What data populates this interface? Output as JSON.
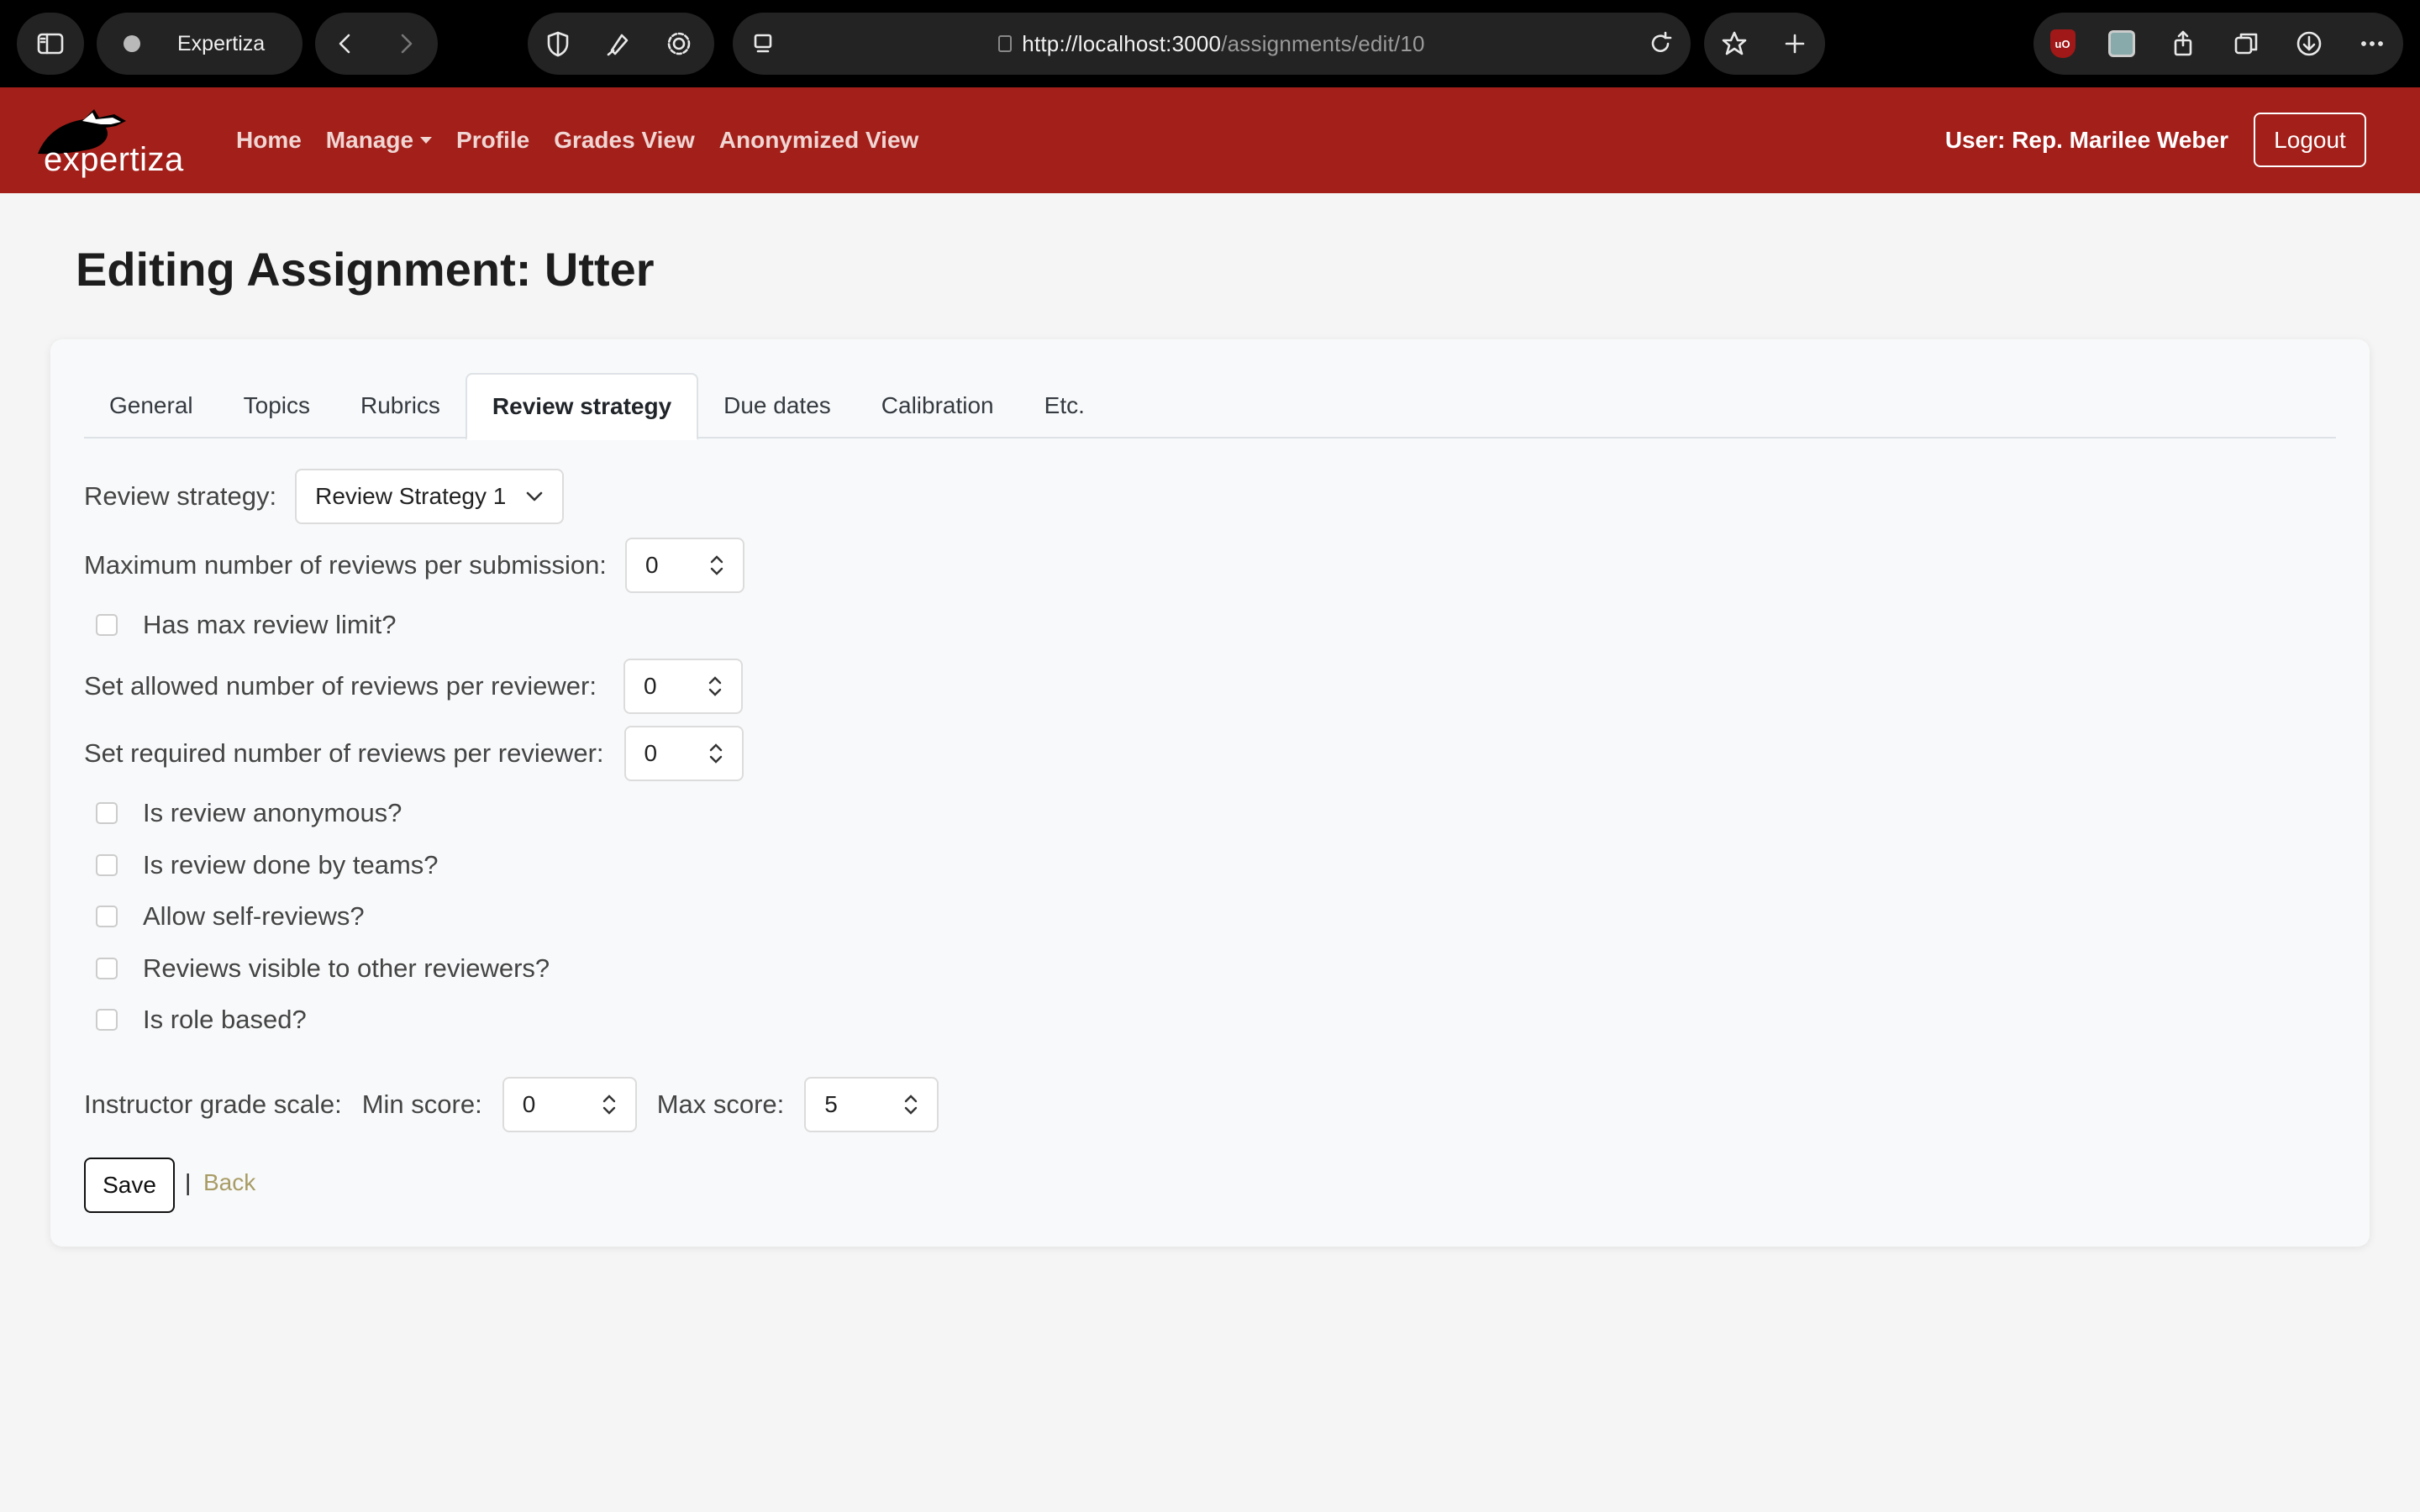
{
  "browser": {
    "tab_title": "Expertiza",
    "url_host": "http://localhost:3000",
    "url_path": "/assignments/edit/10"
  },
  "navbar": {
    "logo_text": "expertiza",
    "links": [
      "Home",
      "Manage",
      "Profile",
      "Grades View",
      "Anonymized View"
    ],
    "user_label": "User: Rep. Marilee Weber",
    "logout_label": "Logout"
  },
  "page": {
    "title": "Editing Assignment: Utter"
  },
  "tabs": [
    "General",
    "Topics",
    "Rubrics",
    "Review strategy",
    "Due dates",
    "Calibration",
    "Etc."
  ],
  "active_tab": "Review strategy",
  "form": {
    "review_strategy_label": "Review strategy:",
    "review_strategy_value": "Review Strategy 1",
    "max_reviews_label": "Maximum number of reviews per submission:",
    "max_reviews_value": "0",
    "has_max_review_limit_label": "Has max review limit?",
    "allowed_reviews_label": "Set allowed number of reviews per reviewer:",
    "allowed_reviews_value": "0",
    "required_reviews_label": "Set required number of reviews per reviewer:",
    "required_reviews_value": "0",
    "checkboxes": [
      "Is review anonymous?",
      "Is review done by teams?",
      "Allow self-reviews?",
      "Reviews visible to other reviewers?",
      "Is role based?"
    ],
    "grade_scale_label": "Instructor grade scale:",
    "min_score_label": "Min score:",
    "min_score_value": "0",
    "max_score_label": "Max score:",
    "max_score_value": "5",
    "save_label": "Save",
    "separator": "|",
    "back_label": "Back"
  },
  "colors": {
    "navbar": "#a31f1a",
    "back_link": "#a89c66"
  }
}
